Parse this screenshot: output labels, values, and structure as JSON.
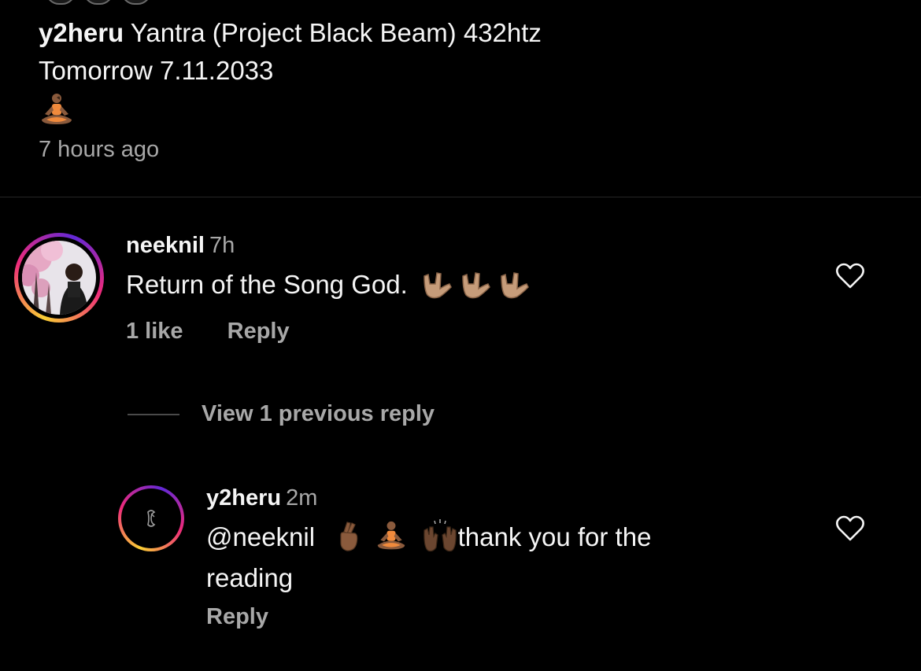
{
  "post_caption": {
    "username": "y2heru",
    "text": "Yantra (Project Black Beam) 432htz",
    "line2": "Tomorrow 7.11.2033",
    "emoji": "person-in-lotus-position",
    "time": "7 hours ago"
  },
  "comments": [
    {
      "username": "neeknil",
      "time": "7h",
      "text": "Return of the Song God.",
      "emojis": [
        "sign-of-the-horns",
        "sign-of-the-horns",
        "sign-of-the-horns"
      ],
      "likes": "1 like",
      "reply_label": "Reply",
      "heart_icon": "heart-outline-icon"
    }
  ],
  "view_replies_label": "View 1 previous reply",
  "reply": {
    "username": "y2heru",
    "time": "2m",
    "mention": "@neeknil",
    "emojis": [
      "crossed-fingers",
      "person-in-lotus-position",
      "raising-hands"
    ],
    "text": "thank you for the",
    "text2": "reading",
    "reply_label": "Reply",
    "heart_icon": "heart-outline-icon"
  },
  "colors": {
    "background": "#000000",
    "primary_text": "#f5f5f5",
    "secondary_text": "#a8a8a8",
    "divider": "#262626",
    "skin_tone": "#a0785a"
  }
}
